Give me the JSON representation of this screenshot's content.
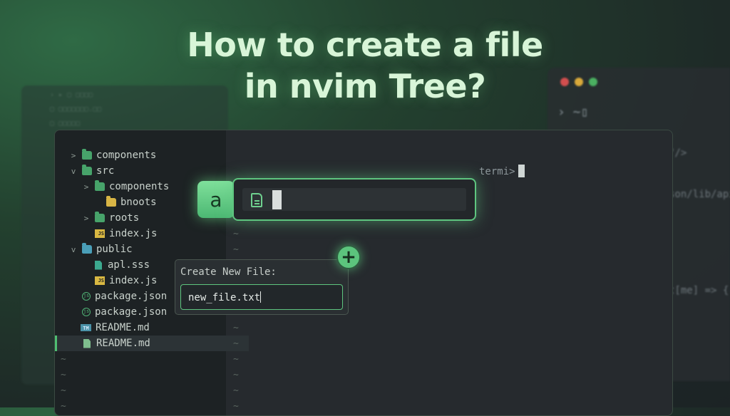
{
  "title": {
    "line1": "How to create a file",
    "line2": "in nvim Tree?"
  },
  "colors": {
    "accent": "#5ec57f",
    "folder_green": "#47a36a",
    "folder_yellow": "#d8b545",
    "js_yellow": "#d9b842"
  },
  "tree": [
    {
      "label": "components",
      "icon": "folder-icon",
      "chevron": "right"
    },
    {
      "label": "src",
      "icon": "folder-open-icon",
      "chevron": "down"
    },
    {
      "label": "components",
      "icon": "folder-icon",
      "chevron": "right"
    },
    {
      "label": "bnoots",
      "icon": "folder-yellow-icon",
      "chevron": ""
    },
    {
      "label": "roots",
      "icon": "folder-icon",
      "chevron": "right"
    },
    {
      "label": "index.js",
      "icon": "js-file-icon",
      "chevron": ""
    },
    {
      "label": "public",
      "icon": "folder-open-icon",
      "chevron": "down"
    },
    {
      "label": "apl.sss",
      "icon": "css-file-icon",
      "chevron": ""
    },
    {
      "label": "index.js",
      "icon": "js-file-icon",
      "chevron": ""
    },
    {
      "label": "package.json",
      "icon": "node-icon",
      "chevron": ""
    },
    {
      "label": "package.json",
      "icon": "node-icon",
      "chevron": ""
    },
    {
      "label": "README.md",
      "icon": "tm-icon",
      "chevron": ""
    },
    {
      "label": "README.md",
      "icon": "markdown-file-icon",
      "chevron": "",
      "selected": true
    }
  ],
  "terminal": {
    "prompt": "termi>"
  },
  "key": {
    "label": "a"
  },
  "plus": {
    "label": "+"
  },
  "dialog": {
    "label": "Create New File:",
    "value": "new_file.txt"
  },
  "tilde": "~"
}
